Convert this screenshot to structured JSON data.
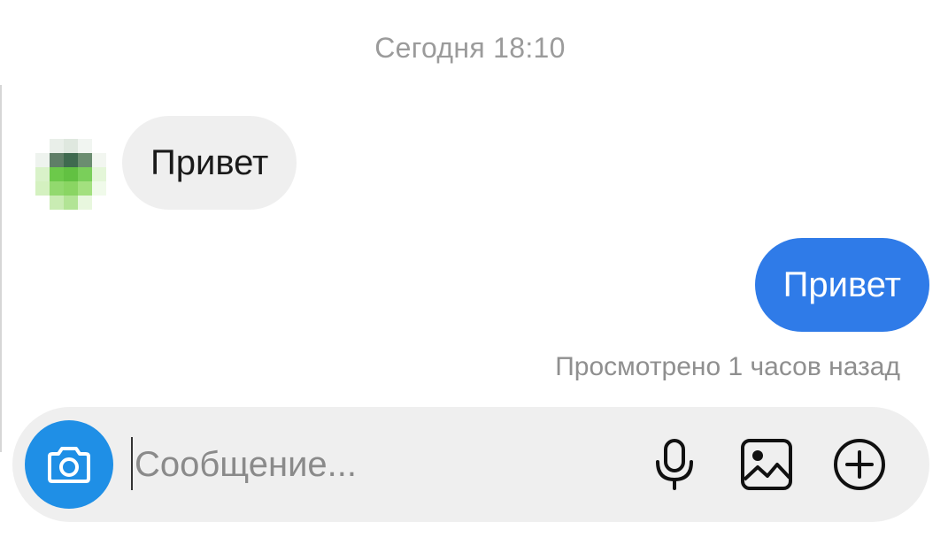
{
  "chat": {
    "timestamp": "Сегодня 18:10",
    "messages": [
      {
        "direction": "incoming",
        "text": "Привет"
      },
      {
        "direction": "outgoing",
        "text": "Привет"
      }
    ],
    "seen_status": "Просмотрено 1 часов назад"
  },
  "composer": {
    "placeholder": "Сообщение...",
    "value": "",
    "icons": {
      "camera": "camera-icon",
      "microphone": "microphone-icon",
      "gallery": "image-icon",
      "more": "plus-circle-icon"
    }
  },
  "colors": {
    "outgoing_bubble": "#2f7be8",
    "incoming_bubble": "#efefef",
    "camera_button": "#1f8fe6",
    "composer_background": "#efefef",
    "meta_text": "#9b9b9b"
  }
}
